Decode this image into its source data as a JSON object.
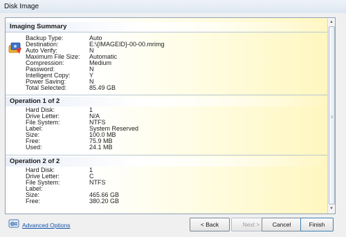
{
  "window": {
    "title": "Disk Image"
  },
  "summary": {
    "header": "Imaging Summary",
    "rows": [
      {
        "label": "Backup Type:",
        "value": "Auto"
      },
      {
        "label": "Destination:",
        "value": "E:\\{IMAGEID}-00-00.mrimg"
      },
      {
        "label": "Auto Verify:",
        "value": "N"
      },
      {
        "label": "Maximum File Size:",
        "value": "Automatic"
      },
      {
        "label": "Compression:",
        "value": "Medium"
      },
      {
        "label": "Password:",
        "value": "N"
      },
      {
        "label": "Intelligent Copy:",
        "value": "Y"
      },
      {
        "label": "Power Saving:",
        "value": "N"
      },
      {
        "label": "Total Selected:",
        "value": "85.49 GB"
      }
    ]
  },
  "operation1": {
    "header": "Operation 1 of 2",
    "rows": [
      {
        "label": "Hard Disk:",
        "value": "1"
      },
      {
        "label": "Drive Letter:",
        "value": "N/A"
      },
      {
        "label": "File System:",
        "value": "NTFS"
      },
      {
        "label": "Label:",
        "value": "System Reserved"
      },
      {
        "label": "Size:",
        "value": "100.0 MB"
      },
      {
        "label": "Free:",
        "value": "75.9 MB"
      },
      {
        "label": "Used:",
        "value": "24.1 MB"
      }
    ]
  },
  "operation2": {
    "header": "Operation 2 of 2",
    "rows": [
      {
        "label": "Hard Disk:",
        "value": "1"
      },
      {
        "label": "Drive Letter:",
        "value": "C"
      },
      {
        "label": "File System:",
        "value": "NTFS"
      },
      {
        "label": "Label:",
        "value": ""
      },
      {
        "label": "Size:",
        "value": "465.66 GB"
      },
      {
        "label": "Free:",
        "value": "380.20 GB"
      }
    ]
  },
  "footer": {
    "advanced_options": "Advanced Options",
    "back": "< Back",
    "next": "Next >",
    "cancel": "Cancel",
    "finish": "Finish"
  },
  "icons": {
    "app": "disk-image-app-icon",
    "advanced": "advanced-options-icon",
    "scroll_up": "scroll-up-icon",
    "scroll_down": "scroll-down-icon"
  }
}
